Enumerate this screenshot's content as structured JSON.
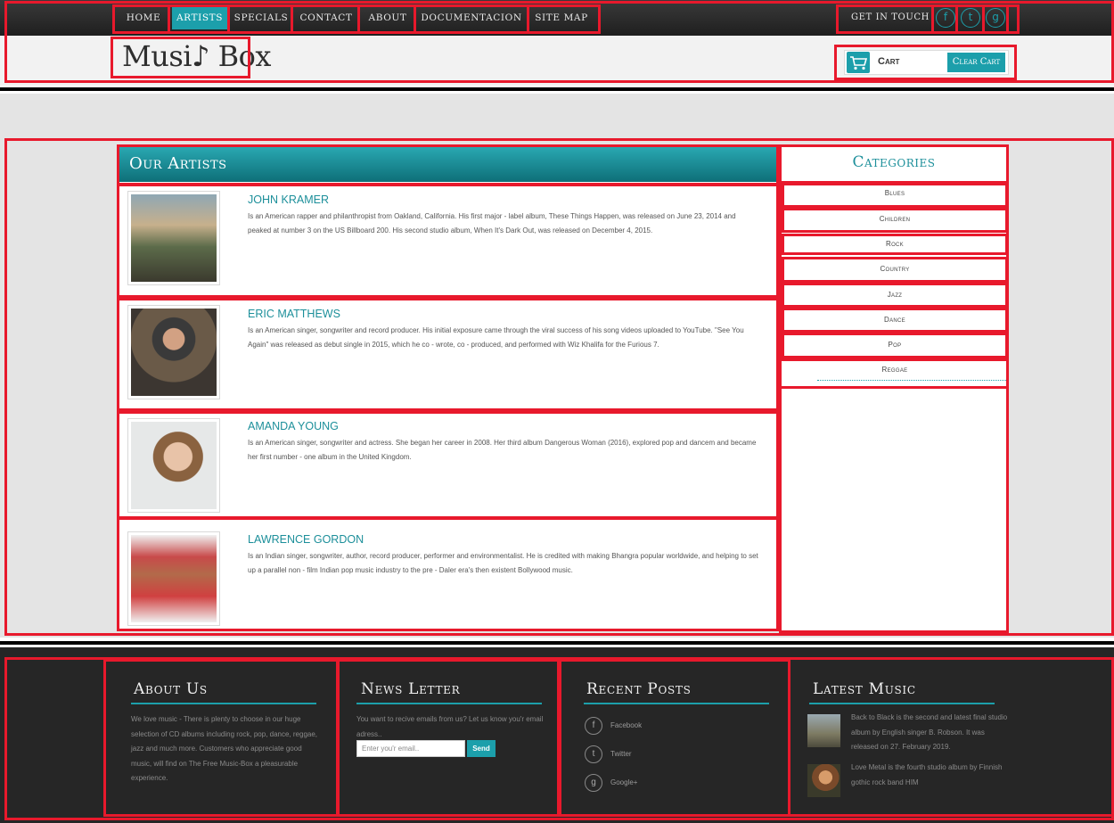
{
  "nav": {
    "items": [
      "Home",
      "Artists",
      "Specials",
      "Contact",
      "About",
      "Documentacion",
      "Site map"
    ],
    "active": "Artists",
    "get_in_touch": "GET IN TOUCH",
    "social": [
      "f",
      "t",
      "g"
    ]
  },
  "header": {
    "logo": "Musi♪ Box",
    "cart_label": "Cart",
    "clear_cart_label": "Clear Cart"
  },
  "artists": {
    "title": "Our Artists",
    "items": [
      {
        "name": "JOHN KRAMER",
        "description": "Is an American rapper and philanthropist from Oakland, California. His first major - label album, These Things Happen, was released on June 23, 2014 and peaked at number 3 on the US Billboard 200. His second studio album, When It's Dark Out, was released on December 4, 2015."
      },
      {
        "name": "ERIC MATTHEWS",
        "description": "Is an American singer, songwriter and record producer. His initial exposure came through the viral success of his song videos uploaded to YouTube. \"See You Again\" was released as debut single in 2015, which he co - wrote, co - produced, and performed with Wiz Khalifa for the Furious 7."
      },
      {
        "name": "AMANDA YOUNG",
        "description": "Is an American singer, songwriter and actress. She began her career in 2008. Her third album Dangerous Woman (2016), explored pop and dancem and became her first number - one album in the United Kingdom."
      },
      {
        "name": "LAWRENCE GORDON",
        "description": "Is an Indian singer, songwriter, author, record producer, performer and environmentalist. He is credited with making Bhangra popular worldwide, and helping to set up a parallel non - film Indian pop music industry to the pre - Daler era's then existent Bollywood music."
      }
    ]
  },
  "categories": {
    "title": "Categories",
    "items": [
      "Blues",
      "Children",
      "Rock",
      "Country",
      "Jazz",
      "Dance",
      "Pop",
      "Reggae"
    ]
  },
  "footer": {
    "about": {
      "title": "About Us",
      "text": "We love music - There is plenty to choose in our huge selection of CD albums including rock, pop, dance, reggae, jazz and much more. Customers who appreciate good music, will find on The Free Music-Box a pleasurable experience."
    },
    "newsletter": {
      "title": "News Letter",
      "text": "You want to recive emails from us? Let us know you'r email adress..",
      "placeholder": "Enter you'r email..",
      "send_label": "Send"
    },
    "recent_posts": {
      "title": "Recent Posts",
      "items": [
        {
          "icon": "f",
          "label": "Facebook"
        },
        {
          "icon": "t",
          "label": "Twitter"
        },
        {
          "icon": "g",
          "label": "Google+"
        }
      ]
    },
    "latest_music": {
      "title": "Latest Music",
      "items": [
        {
          "text": "Back to Black is the second and latest final studio album by English singer B. Robson. It was released on 27. February 2019."
        },
        {
          "text": "Love Metal is the fourth studio album by Finnish gothic rock band HIM"
        }
      ]
    }
  },
  "colors": {
    "accent": "#1c9fab",
    "annotation_border": "#e8192c"
  }
}
